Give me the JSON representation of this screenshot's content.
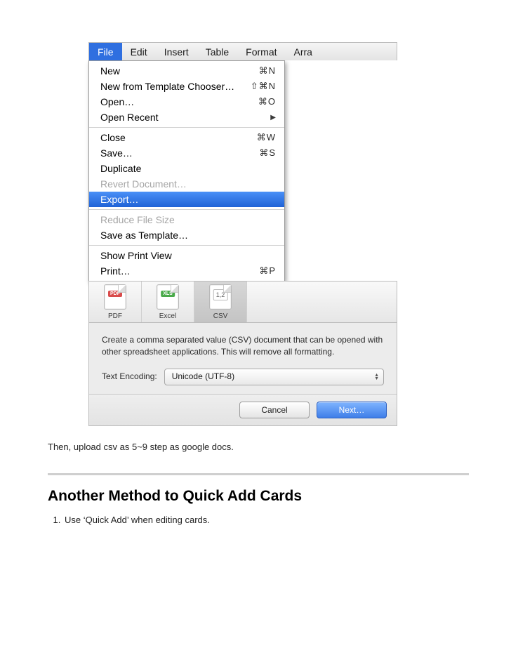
{
  "menubar": {
    "items": [
      {
        "label": "File"
      },
      {
        "label": "Edit"
      },
      {
        "label": "Insert"
      },
      {
        "label": "Table"
      },
      {
        "label": "Format"
      },
      {
        "label": "Arra"
      }
    ]
  },
  "file_menu": {
    "sections": [
      [
        {
          "label": "New",
          "shortcut": "⌘N",
          "type": "item"
        },
        {
          "label": "New from Template Chooser…",
          "shortcut": "⇧⌘N",
          "type": "item"
        },
        {
          "label": "Open…",
          "shortcut": "⌘O",
          "type": "item"
        },
        {
          "label": "Open Recent",
          "shortcut": "",
          "type": "submenu"
        }
      ],
      [
        {
          "label": "Close",
          "shortcut": "⌘W",
          "type": "item"
        },
        {
          "label": "Save…",
          "shortcut": "⌘S",
          "type": "item"
        },
        {
          "label": "Duplicate",
          "shortcut": "",
          "type": "item"
        },
        {
          "label": "Revert Document…",
          "shortcut": "",
          "type": "disabled"
        },
        {
          "label": "Export…",
          "shortcut": "",
          "type": "highlight"
        }
      ],
      [
        {
          "label": "Reduce File Size",
          "shortcut": "",
          "type": "disabled"
        },
        {
          "label": "Save as Template…",
          "shortcut": "",
          "type": "item"
        }
      ],
      [
        {
          "label": "Show Print View",
          "shortcut": "",
          "type": "item"
        },
        {
          "label": "Print…",
          "shortcut": "⌘P",
          "type": "item"
        }
      ]
    ]
  },
  "export_dialog": {
    "tabs": [
      {
        "label": "PDF",
        "badge": "PDF",
        "badge_class": "pdf"
      },
      {
        "label": "Excel",
        "badge": "XLS",
        "badge_class": "xls"
      },
      {
        "label": "CSV",
        "badge": "1,2",
        "badge_class": "csv"
      }
    ],
    "description": "Create a comma separated value (CSV) document that can be opened with other spreadsheet applications. This will remove all formatting.",
    "encoding_label": "Text Encoding:",
    "encoding_value": "Unicode (UTF-8)",
    "buttons": {
      "cancel": "Cancel",
      "next": "Next…"
    }
  },
  "doc": {
    "line_after": "Then, upload csv as 5~9 step as google docs.",
    "heading": "Another Method to Quick Add Cards",
    "list": [
      "Use ‘Quick Add’ when editing cards."
    ]
  }
}
